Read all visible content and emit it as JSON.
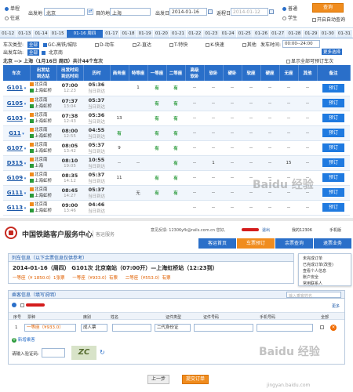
{
  "search": {
    "trip_types": [
      {
        "label": "单程",
        "selected": true
      },
      {
        "label": "往返",
        "selected": false
      }
    ],
    "from_label": "出发地",
    "from_value": "北京",
    "to_label": "目的地",
    "to_value": "上海",
    "depart_label": "出发日",
    "depart_value": "2014-01-16",
    "return_label": "返程日",
    "return_value": "2014-01-12",
    "passenger_types": [
      {
        "label": "普通",
        "selected": true
      },
      {
        "label": "学生",
        "selected": false
      }
    ],
    "query_button": "查询",
    "auto_query": "开启自动查询",
    "swap_icon": "⇄"
  },
  "date_tabs": [
    "01-12",
    "01-13",
    "01-14",
    "01-15",
    "01-16 周四",
    "01-17",
    "01-18",
    "01-19",
    "01-20",
    "01-21",
    "01-22",
    "01-23",
    "01-24",
    "01-25",
    "01-26",
    "01-27",
    "01-28",
    "01-29",
    "01-30",
    "01-31"
  ],
  "filters": {
    "type_label": "车次类型:",
    "types": [
      "全部",
      "GC-高铁/城际",
      "D-动车",
      "Z-直达",
      "T-特快",
      "K-快速",
      "其他"
    ],
    "time_label": "发车时间:",
    "time_value": "00:00--24:00",
    "station_label": "出发车站:",
    "stations": [
      "全部",
      "北京南"
    ],
    "summary": "北京 --> 上海（1月16日 周四）共计44个车次",
    "show_all": "显示全部可预订车次",
    "multi_choice": "更多选择"
  },
  "table": {
    "headers": [
      "车次",
      "出发站\n到达站",
      "出发时间\n到达时间",
      "历时",
      "商务座",
      "特等座",
      "一等座",
      "二等座",
      "高级\n软卧",
      "软卧",
      "硬卧",
      "软座",
      "硬座",
      "无座",
      "其他",
      "备注"
    ],
    "book_label": "预订",
    "rows": [
      {
        "no": "G101",
        "from": "北京南",
        "to": "上海虹桥",
        "dep": "07:00",
        "arr": "12:23",
        "dur": "05:36",
        "day": "当日到达",
        "c": [
          "",
          "1",
          "有",
          "有",
          "--",
          "--",
          "--",
          "--",
          "--",
          "--",
          "--"
        ]
      },
      {
        "no": "G105",
        "from": "北京南",
        "to": "上海虹桥",
        "dep": "07:37",
        "arr": "13:04",
        "dur": "05:37",
        "day": "当日到达",
        "c": [
          "",
          "",
          "有",
          "有",
          "--",
          "--",
          "--",
          "--",
          "--",
          "--",
          "--"
        ]
      },
      {
        "no": "G103",
        "from": "北京南",
        "to": "上海虹桥",
        "dep": "07:38",
        "arr": "12:43",
        "dur": "05:36",
        "day": "当日到达",
        "c": [
          "13",
          "",
          "有",
          "有",
          "--",
          "--",
          "--",
          "--",
          "--",
          "--",
          "--"
        ]
      },
      {
        "no": "G11",
        "from": "北京南",
        "to": "上海虹桥",
        "dep": "08:00",
        "arr": "12:55",
        "dur": "04:55",
        "day": "当日到达",
        "c": [
          "有",
          "",
          "有",
          "有",
          "--",
          "--",
          "--",
          "--",
          "--",
          "--",
          "--"
        ]
      },
      {
        "no": "G107",
        "from": "北京南",
        "to": "上海虹桥",
        "dep": "08:05",
        "arr": "13:42",
        "dur": "05:37",
        "day": "当日到达",
        "c": [
          "9",
          "",
          "有",
          "有",
          "--",
          "--",
          "--",
          "--",
          "--",
          "--",
          "--"
        ]
      },
      {
        "no": "D315",
        "from": "北京南",
        "to": "上海",
        "dep": "08:10",
        "arr": "19:05",
        "dur": "10:55",
        "day": "当日到达",
        "c": [
          "--",
          "--",
          "",
          "有",
          "--",
          "1",
          "--",
          "--",
          "--",
          "15",
          "--"
        ]
      },
      {
        "no": "G109",
        "from": "北京南",
        "to": "上海虹桥",
        "dep": "08:35",
        "arr": "14:12",
        "dur": "05:37",
        "day": "当日到达",
        "c": [
          "11",
          "",
          "有",
          "有",
          "--",
          "--",
          "--",
          "--",
          "--",
          "--",
          "--"
        ]
      },
      {
        "no": "G111",
        "from": "北京南",
        "to": "上海虹桥",
        "dep": "08:45",
        "arr": "14:27",
        "dur": "05:37",
        "day": "当日到达",
        "c": [
          "",
          "无",
          "有",
          "有",
          "--",
          "--",
          "--",
          "--",
          "--",
          "--",
          "--"
        ]
      },
      {
        "no": "G113",
        "from": "北京南",
        "to": "上海虹桥",
        "dep": "09:00",
        "arr": "13:46",
        "dur": "04:46",
        "day": "当日到达",
        "c": [
          "",
          "",
          "",
          "",
          "--",
          "--",
          "--",
          "--",
          "--",
          "--",
          "--"
        ]
      }
    ]
  },
  "site": {
    "name": "中国铁路客户服务中心",
    "sub": "客运服务",
    "user_text": "意见反馈: 12306yfk@rails.com.cn  您好,",
    "logout": "退出",
    "my12306": "我的12306",
    "mobile": "手机版",
    "nav": [
      "客运首页",
      "车票预订",
      "余票查询",
      "退票业务"
    ],
    "dropdown": [
      "未完成订单",
      "已完成订单(改签)",
      "查看个人信息",
      "账户安全",
      "常用联系人"
    ]
  },
  "order": {
    "info_title": "列车信息（以下余票信息仅供参考）",
    "line1_date": "2014-01-16（周四）",
    "line1_train": "G101次 北京南站（07:00开）—上海虹桥站（12:23到）",
    "prices": [
      "一等座（¥933.0）有票",
      "二等座（¥553.0）有票"
    ],
    "price_first": "一等座（¥ 1850.0）1张票",
    "passenger_title": "乘客信息（填写说明）",
    "search_placeholder": "输入乘客姓名",
    "more": "更多",
    "col_headers": [
      "序号",
      "票种",
      "席别",
      "姓名",
      "证件类型",
      "证件号码",
      "手机号码",
      "全部"
    ],
    "row_index": "1",
    "ticket_type": "成人票",
    "seat": "一等座（¥933.0）",
    "id_type": "二代身份证",
    "add_passenger": "新增乘客",
    "captcha_label": "请输入验证码:",
    "captcha_text": "ZC",
    "prev_button": "上一步",
    "submit_button": "提交订单",
    "watermark": "Baidu 经验",
    "watermark_sub": "jingyan.baidu.com"
  }
}
